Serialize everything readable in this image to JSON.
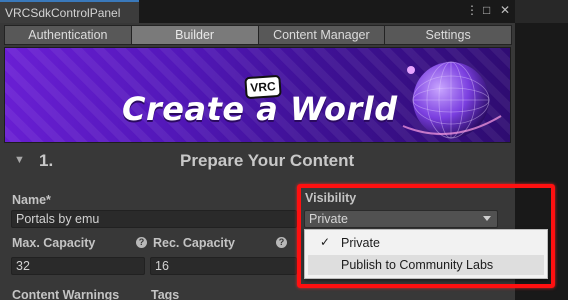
{
  "window": {
    "tab_title": "VRCSdkControlPanel",
    "controls": {
      "more": "⋮",
      "maximize": "□",
      "close": "✕"
    }
  },
  "toolbar": {
    "tabs": [
      {
        "label": "Authentication",
        "active": false
      },
      {
        "label": "Builder",
        "active": true
      },
      {
        "label": "Content Manager",
        "active": false
      },
      {
        "label": "Settings",
        "active": false
      }
    ]
  },
  "banner": {
    "logo_text": "VRC",
    "title": "Create a World"
  },
  "section": {
    "number": "1.",
    "title": "Prepare Your Content"
  },
  "form": {
    "name_label": "Name*",
    "name_value": "Portals by emu",
    "max_capacity_label": "Max. Capacity",
    "max_capacity_value": "32",
    "rec_capacity_label": "Rec. Capacity",
    "rec_capacity_value": "16",
    "help_glyph": "?",
    "content_warnings_label": "Content Warnings",
    "tags_label": "Tags",
    "visibility_label": "Visibility",
    "visibility_value": "Private"
  },
  "dropdown": {
    "check_glyph": "✓",
    "options": [
      {
        "label": "Private",
        "selected": true,
        "hovered": false
      },
      {
        "label": "Publish to Community Labs",
        "selected": false,
        "hovered": true
      }
    ]
  },
  "colors": {
    "accent_tab": "#3a79bb",
    "highlight": "#ff1010",
    "banner_start": "#6a1fd4",
    "banner_end": "#2e0c70"
  }
}
